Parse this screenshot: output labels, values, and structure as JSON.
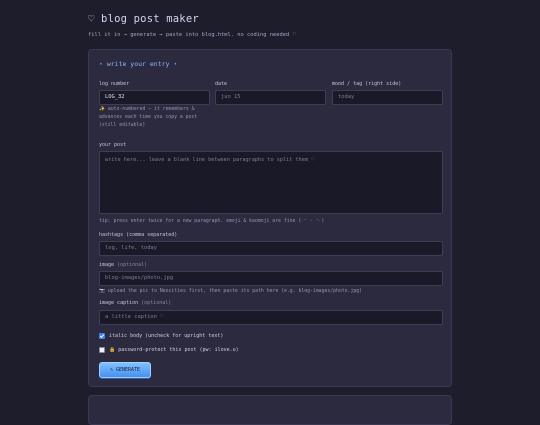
{
  "header": {
    "title": "♡ blog post maker",
    "subtitle": "fill it in → generate → paste into blog.html. no coding needed ♡"
  },
  "form": {
    "section_title": "⋆ write your entry ⋆",
    "log_number": {
      "label": "log number",
      "value": "LOG_32"
    },
    "date": {
      "label": "date",
      "placeholder": "jun 15"
    },
    "mood": {
      "label": "mood / tag (right side)",
      "placeholder": "today"
    },
    "auto_note_line1": "✨ auto-numbered — it remembers &",
    "auto_note_line2": "advances each time you copy a post",
    "auto_note_line3": "(still editable)",
    "post": {
      "label": "your post",
      "placeholder": "write here... leave a blank line between paragraphs to split them ♡"
    },
    "post_tip": "tip: press enter twice for a new paragraph. emoji & kaomoji are fine (˶ᵔ ᵕ ᵔ˶)",
    "hashtags": {
      "label": "hashtags (comma separated)",
      "placeholder": "log, life, today"
    },
    "image": {
      "label": "image",
      "label_optional": "(optional)",
      "placeholder": "blog-images/photo.jpg",
      "hint": "📷 upload the pic to Neocities first, then paste its path here (e.g. blog-images/photo.jpg)"
    },
    "caption": {
      "label": "image caption",
      "label_optional": "(optional)",
      "placeholder": "a little caption ♡"
    },
    "italic_checkbox": {
      "label": "italic body (uncheck for upright text)",
      "checked": true
    },
    "password_checkbox": {
      "label": "🔒 password-protect this post (pw: ilove.u)",
      "checked": false
    },
    "generate_button": "✎ GENERATE"
  },
  "colors": {
    "background": "#1e1d2c",
    "panel": "#2b2a3e",
    "accent": "#8fb7ff",
    "button": "#5ca4f6"
  }
}
